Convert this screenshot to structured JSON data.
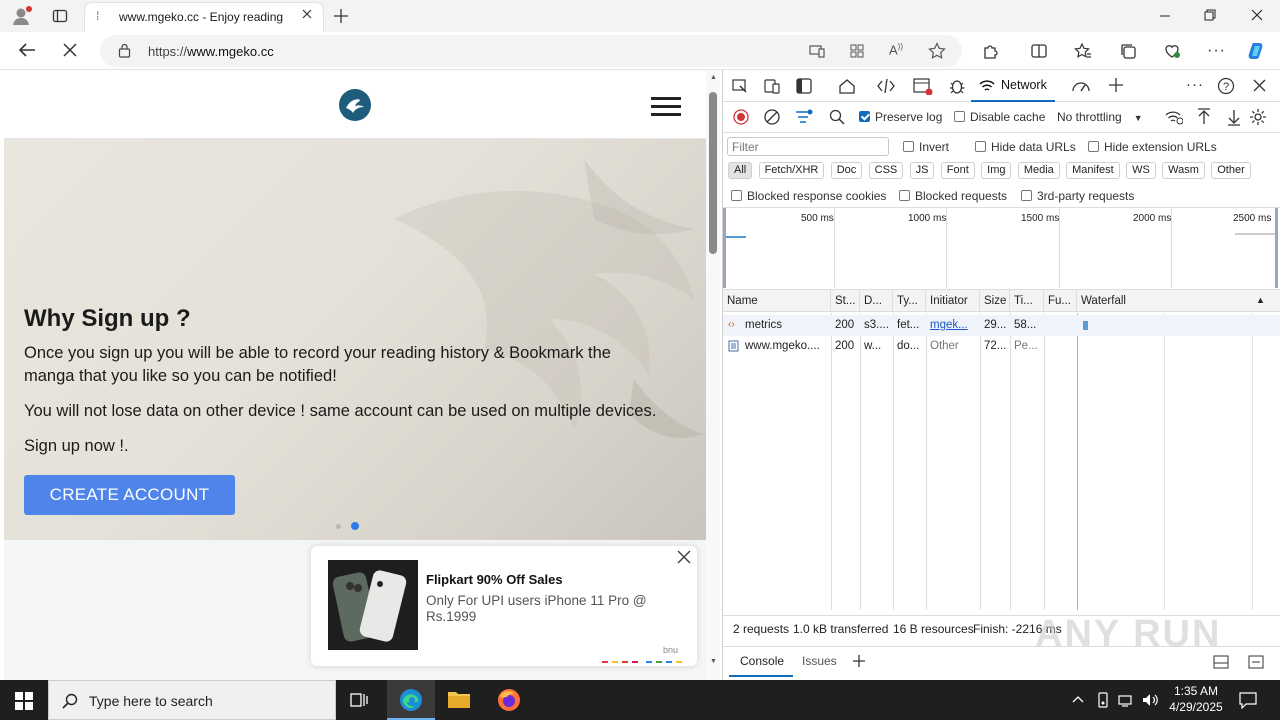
{
  "browser": {
    "tab_title": "www.mgeko.cc - Enjoy reading",
    "url_prefix": "https://",
    "url_host": "www.mgeko.cc"
  },
  "page": {
    "heading": "Why Sign up ?",
    "paragraph1": "Once you sign up you will be able to record your reading history & Bookmark the manga that you like so you can be notified!",
    "paragraph2": "You will not lose data on other device ! same account can be used on multiple devices.",
    "paragraph3": "Sign up now !.",
    "cta_label": "CREATE ACCOUNT",
    "slides_total": 2,
    "active_slide": 2
  },
  "ad": {
    "title": "Flipkart 90% Off Sales",
    "desc": "Only For UPI users iPhone 11 Pro @ Rs.1999",
    "brand": "bnu"
  },
  "devtools": {
    "active_tab": "Network",
    "preserve_log": "Preserve log",
    "disable_cache": "Disable cache",
    "throttling": "No throttling",
    "filter_placeholder": "Filter",
    "invert": "Invert",
    "hide_data_urls": "Hide data URLs",
    "hide_extension_urls": "Hide extension URLs",
    "type_filters": [
      "All",
      "Fetch/XHR",
      "Doc",
      "CSS",
      "JS",
      "Font",
      "Img",
      "Media",
      "Manifest",
      "WS",
      "Wasm",
      "Other"
    ],
    "blocked_response_cookies": "Blocked response cookies",
    "blocked_requests": "Blocked requests",
    "third_party_requests": "3rd-party requests",
    "timeline_ticks": [
      "500 ms",
      "1000 ms",
      "1500 ms",
      "2000 ms",
      "2500 ms"
    ],
    "columns": [
      "Name",
      "St...",
      "D...",
      "Ty...",
      "Initiator",
      "Size",
      "Ti...",
      "Fu...",
      "Waterfall"
    ],
    "rows": [
      {
        "name": "metrics",
        "status": "200",
        "domain": "s3....",
        "type": "fet...",
        "initiator": "mgek...",
        "size": "29...",
        "time": "58...",
        "fu": ""
      },
      {
        "name": "www.mgeko....",
        "status": "200",
        "domain": "w...",
        "type": "do...",
        "initiator": "Other",
        "size": "72...",
        "time": "Pe...",
        "fu": ""
      }
    ],
    "summary": {
      "requests": "2 requests",
      "transferred": "1.0 kB transferred",
      "resources": "16 B resources",
      "finish": "Finish: -2216 ms"
    },
    "drawer_tabs": [
      "Console",
      "Issues"
    ]
  },
  "taskbar": {
    "search_placeholder": "Type here to search",
    "time": "1:35 AM",
    "date": "4/29/2025"
  },
  "watermark": "ANY RUN",
  "colors": {
    "cta": "#4f84ea",
    "accent": "#0f6cbd",
    "record": "#d13438"
  }
}
